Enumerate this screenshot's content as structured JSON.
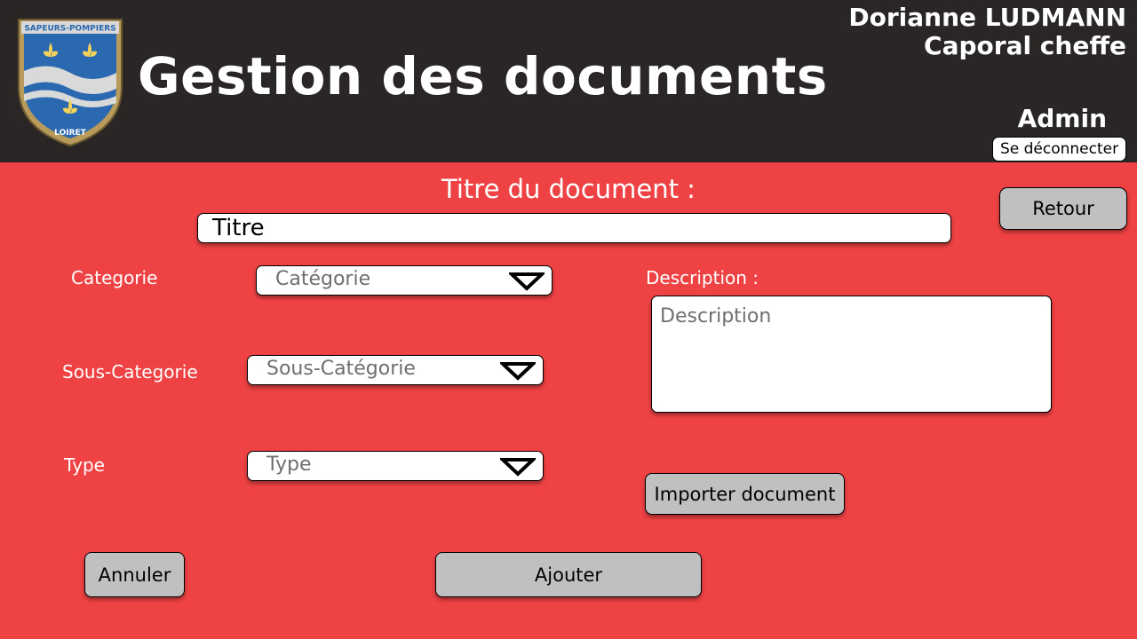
{
  "header": {
    "logo": {
      "top_text": "SAPEURS-POMPIERS",
      "bottom_text": "LOIRET"
    },
    "title": "Gestion des documents",
    "user": {
      "name": "Dorianne LUDMANN",
      "rank": "Caporal cheffe",
      "role": "Admin"
    },
    "logout_label": "Se déconnecter"
  },
  "form": {
    "title_label": "Titre du document :",
    "title_value": "Titre",
    "back_label": "Retour",
    "category": {
      "label": "Categorie",
      "placeholder": "Catégorie"
    },
    "subcategory": {
      "label": "Sous-Categorie",
      "placeholder": "Sous-Catégorie"
    },
    "type": {
      "label": "Type",
      "placeholder": "Type"
    },
    "description": {
      "label": "Description :",
      "placeholder": "Description"
    },
    "import_label": "Importer document",
    "cancel_label": "Annuler",
    "add_label": "Ajouter"
  },
  "colors": {
    "header_bg": "#2b2626",
    "page_bg": "#ef4244",
    "button_gray": "#c0c0c0"
  }
}
